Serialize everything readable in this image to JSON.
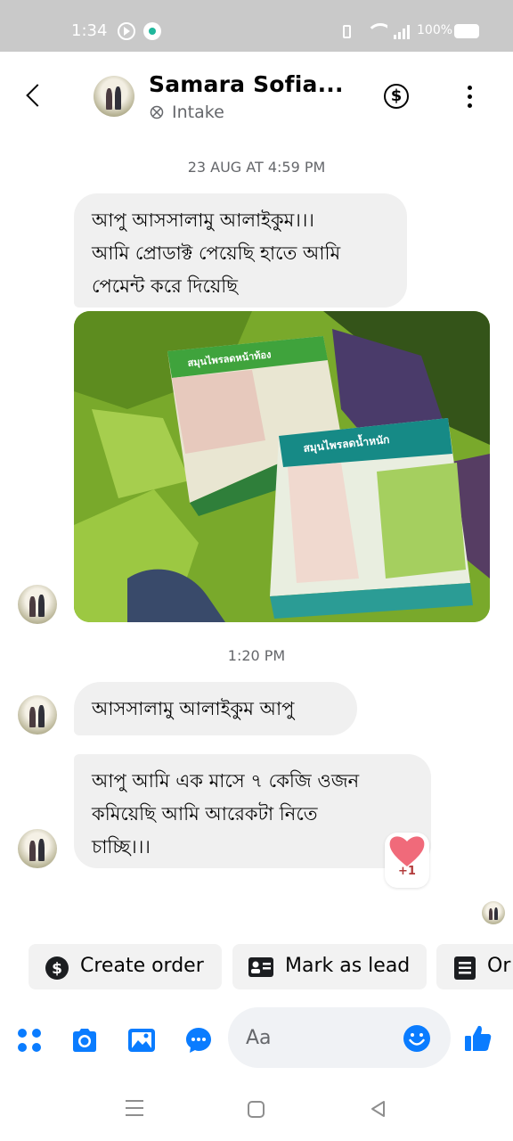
{
  "status_bar": {
    "time": "1:34",
    "battery": "100%"
  },
  "header": {
    "contact_name": "Samara Sofia...",
    "label": "Intake",
    "icons": [
      "back-arrow-icon",
      "intake-icon",
      "dollar-icon",
      "more-vertical-icon"
    ]
  },
  "messages": {
    "timestamp_1": "23 AUG AT 4:59 PM",
    "msg_1": [
      "আপু আসসালামু আলাইকুম।।।",
      "আমি প্রোডাক্ট পেয়েছি হাতে আমি",
      "পেমেন্ট করে দিয়েছি"
    ],
    "photo": {
      "box_1_text": "สมุนไพรลดหน้าท้อง",
      "box_2_text": "สมุนไพรลดน้ำหนัก"
    },
    "timestamp_2": "1:20 PM",
    "msg_2": "আসসালামু আলাইকুম আপু",
    "msg_3": [
      "আপু আমি এক মাসে ৭ কেজি ওজন",
      "কমিয়েছি আমি আরেকটা নিতে",
      "চাচ্ছি।।।"
    ],
    "reaction": {
      "icon": "heart-icon",
      "count": "+1"
    }
  },
  "quick_actions": {
    "create_order": "Create order",
    "mark_as_lead": "Mark as lead",
    "third": "Or"
  },
  "composer": {
    "placeholder": "Aa",
    "icons": [
      "apps-icon",
      "camera-icon",
      "gallery-icon",
      "message-icon",
      "emoji-icon",
      "like-icon"
    ]
  },
  "colors": {
    "accent": "#0a7cff",
    "bubble": "#f0f0f0",
    "status_bar": "#c9c9c9"
  }
}
